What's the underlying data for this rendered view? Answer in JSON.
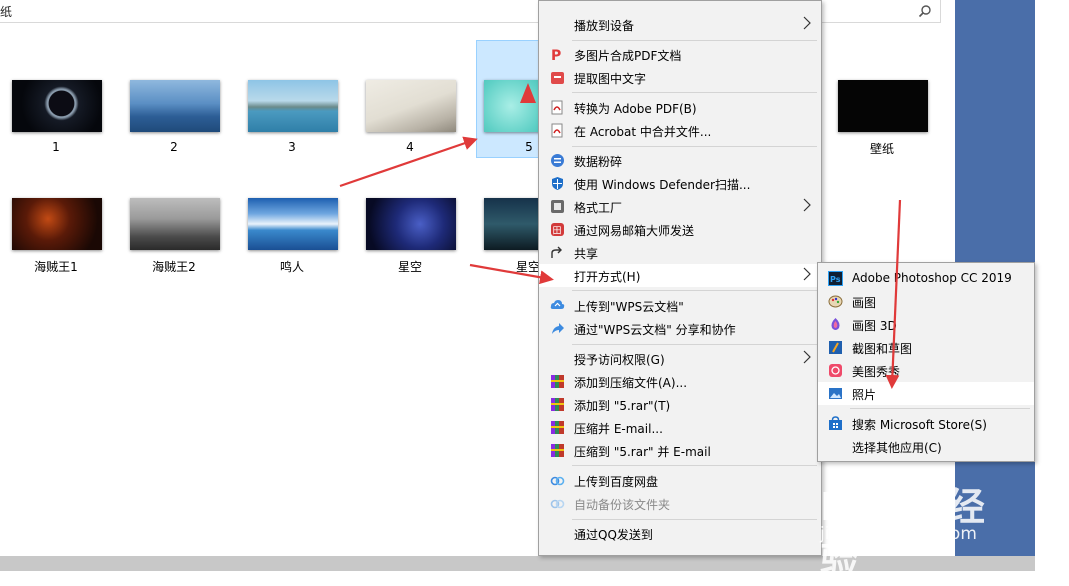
{
  "address_bar": {
    "partial_text": "纸"
  },
  "files": [
    {
      "name": "1"
    },
    {
      "name": "2"
    },
    {
      "name": "3"
    },
    {
      "name": "4"
    },
    {
      "name": "5"
    },
    {
      "name": "壁纸"
    },
    {
      "name": "海贼王1"
    },
    {
      "name": "海贼王2"
    },
    {
      "name": "鸣人"
    },
    {
      "name": "星空"
    },
    {
      "name": "星空"
    }
  ],
  "context_menu": {
    "items": {
      "cast": "播放到设备",
      "pdf_merge": "多图片合成PDF文档",
      "extract_text": "提取图中文字",
      "to_pdf": "转换为 Adobe PDF(B)",
      "acrobat_merge": "在 Acrobat 中合并文件...",
      "shred": "数据粉碎",
      "defender": "使用 Windows Defender扫描...",
      "format_factory": "格式工厂",
      "netease_mail": "通过网易邮箱大师发送",
      "share": "共享",
      "open_with": "打开方式(H)",
      "wps_upload": "上传到\"WPS云文档\"",
      "wps_share": "通过\"WPS云文档\" 分享和协作",
      "grant_access": "授予访问权限(G)",
      "add_archive": "添加到压缩文件(A)...",
      "add_rar": "添加到 \"5.rar\"(T)",
      "compress_email": "压缩并 E-mail...",
      "compress_rar_email": "压缩到 \"5.rar\" 并 E-mail",
      "baidu_upload": "上传到百度网盘",
      "auto_backup": "自动备份该文件夹",
      "qq_send": "通过QQ发送到"
    }
  },
  "open_with_submenu": {
    "photoshop": "Adobe Photoshop CC 2019",
    "paint": "画图",
    "paint3d": "画图 3D",
    "snip": "截图和草图",
    "meitu": "美图秀秀",
    "photos": "照片",
    "store": "搜索 Microsoft Store(S)",
    "other": "选择其他应用(C)"
  },
  "watermark": {
    "brand": "Baidu经验",
    "url": "jingyan.baidu.com"
  },
  "colors": {
    "selection": "#cce8ff",
    "arrow": "#e03a3a",
    "menu_bg": "#f2f2f2",
    "side_panel": "#4a6ea9"
  }
}
